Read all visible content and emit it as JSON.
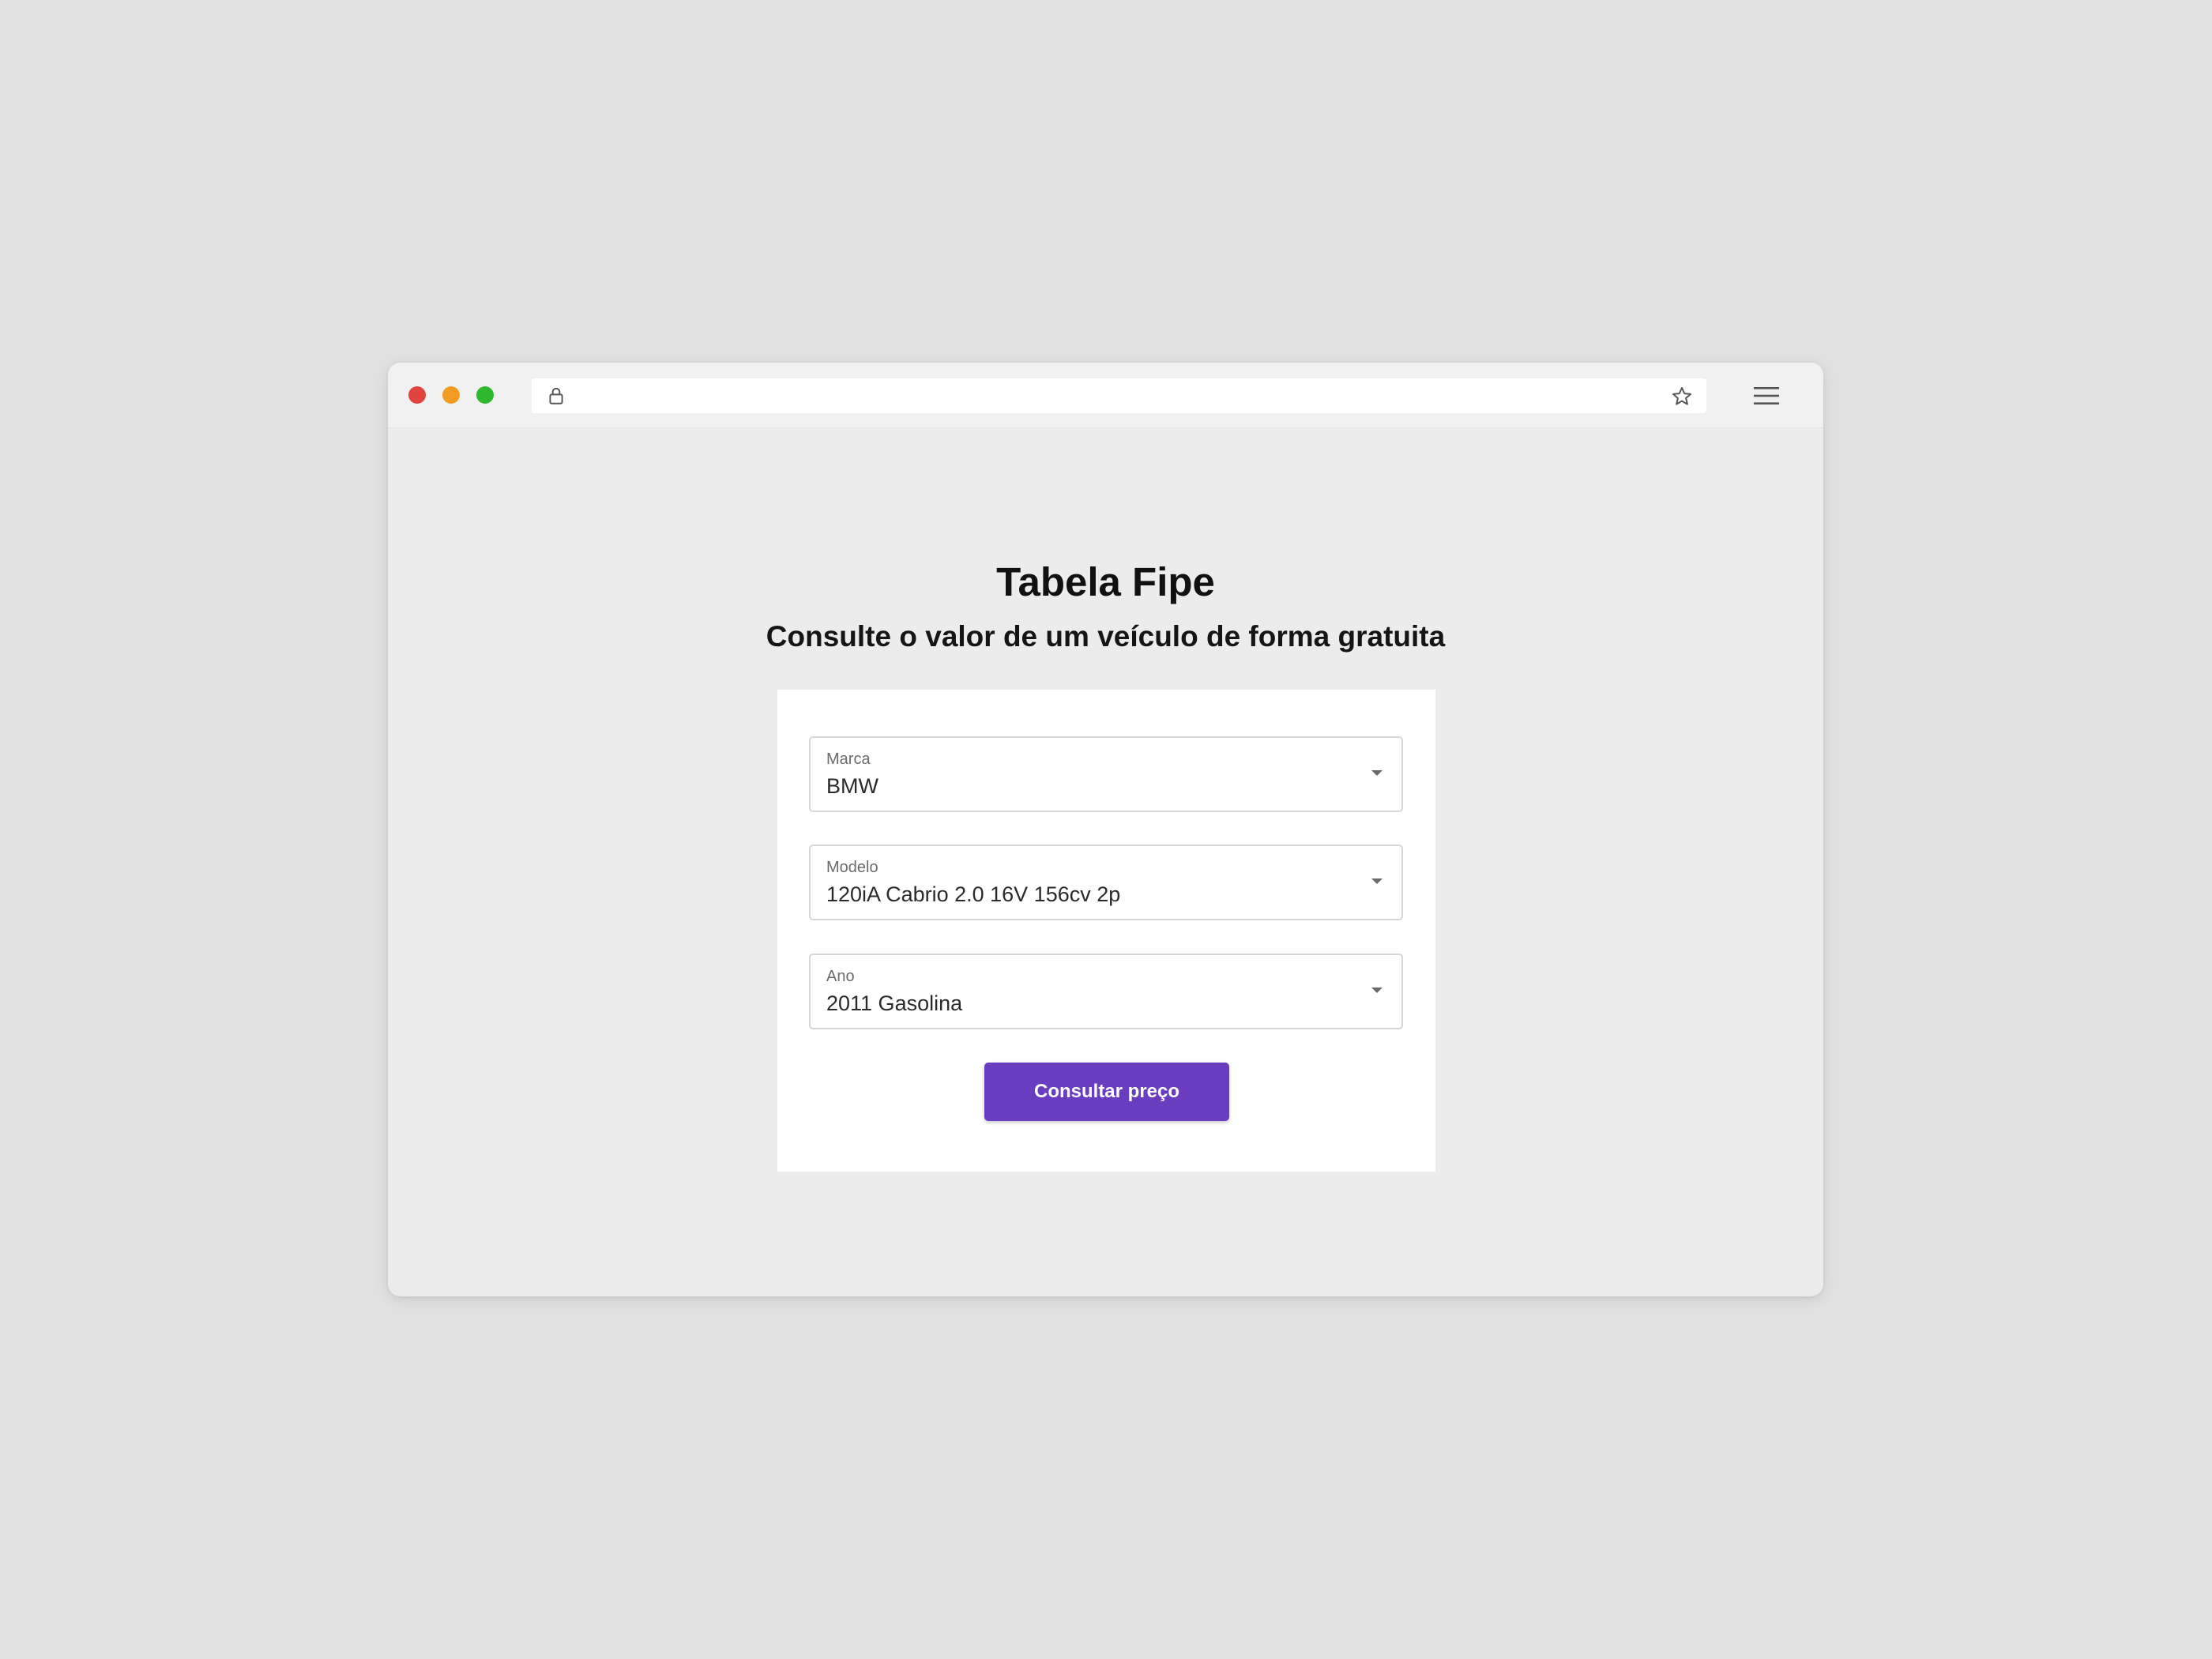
{
  "browser": {
    "controls": {
      "close_color": "#e0443e",
      "minimize_color": "#f29c24",
      "maximize_color": "#2db82d"
    },
    "address": "",
    "icons": [
      "lock-icon",
      "star-icon",
      "hamburger-menu-icon"
    ]
  },
  "page": {
    "title": "Tabela Fipe",
    "subtitle": "Consulte o valor de um veículo de forma gratuita"
  },
  "form": {
    "marca": {
      "label": "Marca",
      "value": "BMW"
    },
    "modelo": {
      "label": "Modelo",
      "value": "120iA Cabrio 2.0 16V 156cv 2p"
    },
    "ano": {
      "label": "Ano",
      "value": "2011 Gasolina"
    },
    "submit_label": "Consultar preço",
    "accent_color": "#6a3cc0"
  }
}
